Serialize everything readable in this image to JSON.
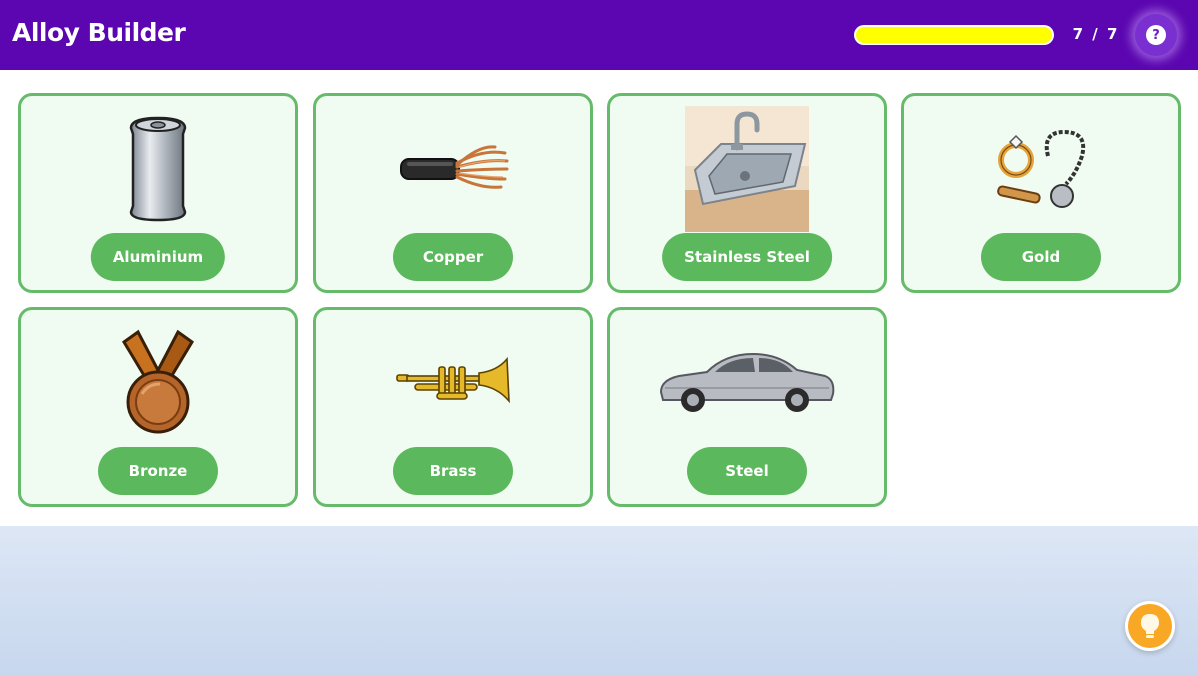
{
  "app": {
    "title": "Alloy Builder"
  },
  "progress": {
    "fraction": 1.0,
    "label": "7 / 7",
    "fill_color": "#ffff00"
  },
  "header": {
    "help_icon": "question-mark-icon",
    "help_glyph": "?"
  },
  "cards": [
    {
      "label": "Aluminium",
      "icon": "soda-can-icon"
    },
    {
      "label": "Copper",
      "icon": "copper-wire-icon"
    },
    {
      "label": "Stainless Steel",
      "icon": "kitchen-sink-icon"
    },
    {
      "label": "Gold",
      "icon": "gold-jewelry-icon"
    },
    {
      "label": "Bronze",
      "icon": "bronze-medal-icon"
    },
    {
      "label": "Brass",
      "icon": "trumpet-icon"
    },
    {
      "label": "Steel",
      "icon": "car-icon"
    }
  ],
  "hint": {
    "icon": "lightbulb-icon"
  },
  "colors": {
    "header": "#5b06b0",
    "card_bg": "#f0fbf1",
    "card_border": "#66bb6a",
    "label_bg": "#5cb85c",
    "hint": "#f9a825"
  }
}
